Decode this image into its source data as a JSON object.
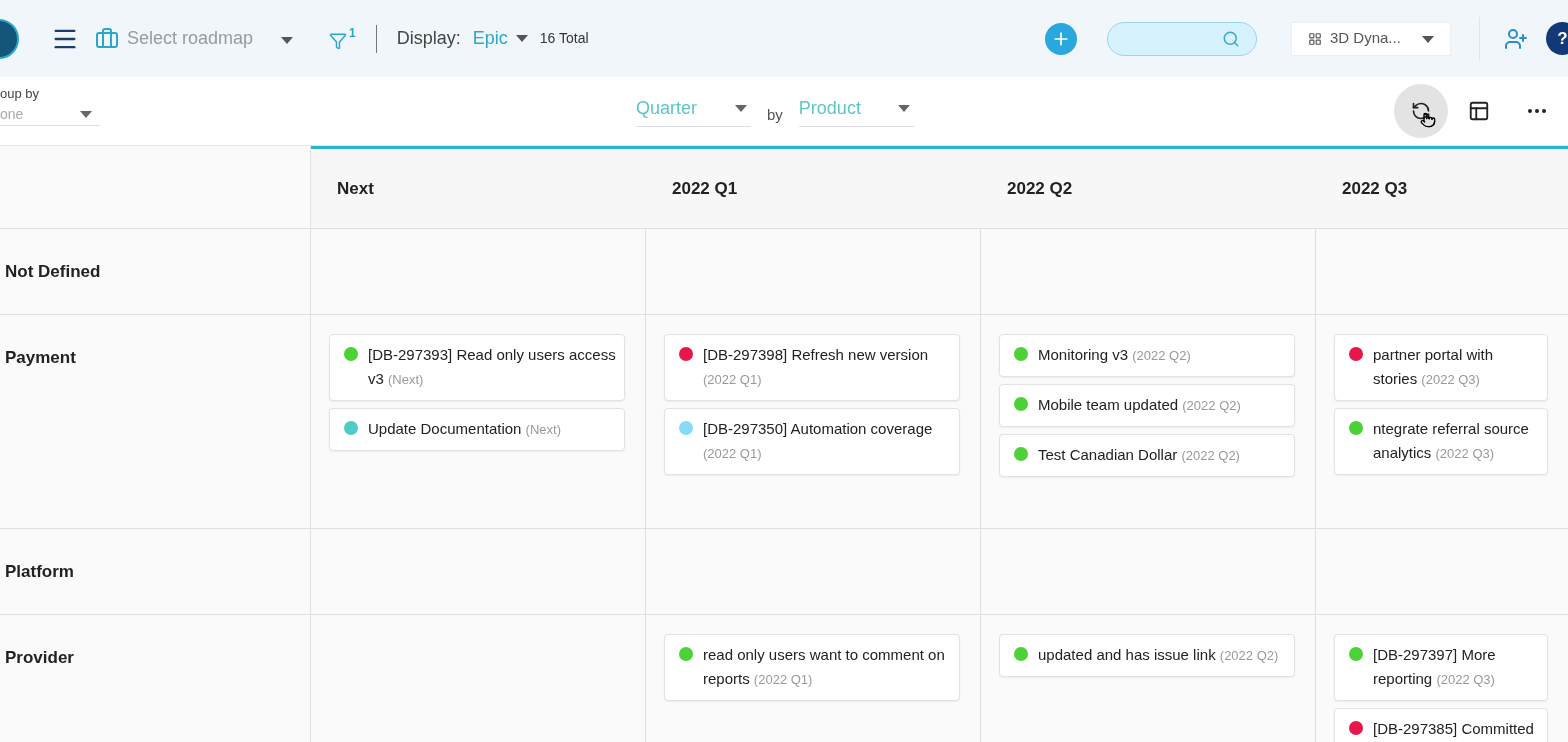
{
  "header": {
    "roadmap_select": "Select roadmap",
    "filter_count": "1",
    "display_label": "Display:",
    "display_value": "Epic",
    "total": "16 Total",
    "workspace": "3D Dyna...",
    "help": "?"
  },
  "toolbar": {
    "group_by_label": "oup by",
    "group_by_value": "one",
    "time_select": "Quarter",
    "by": "by",
    "dimension_select": "Product",
    "tools": [
      {
        "kind": "cycle",
        "hovered": true
      },
      {
        "kind": "layout",
        "hovered": false
      },
      {
        "kind": "more",
        "hovered": false
      }
    ]
  },
  "columns": [
    "Next",
    "2022 Q1",
    "2022 Q2",
    "2022 Q3"
  ],
  "rows": [
    {
      "label": "Not Defined",
      "cells": [
        [],
        [],
        [],
        []
      ]
    },
    {
      "label": "Payment",
      "cells": [
        [
          {
            "title": "[DB-297393] Read only users access v3",
            "period": "(Next)",
            "color": "#4cd137"
          },
          {
            "title": "Update Documentation",
            "period": "(Next)",
            "color": "#4ecdc4"
          }
        ],
        [
          {
            "title": "[DB-297398] Refresh new version",
            "period": "(2022 Q1)",
            "color": "#e8174a"
          },
          {
            "title": "[DB-297350] Automation coverage",
            "period": "(2022 Q1)",
            "color": "#87dcf5"
          }
        ],
        [
          {
            "title": "Monitoring v3",
            "period": "(2022 Q2)",
            "color": "#4cd137"
          },
          {
            "title": "Mobile team updated",
            "period": "(2022 Q2)",
            "color": "#4cd137"
          },
          {
            "title": "Test Canadian Dollar",
            "period": "(2022 Q2)",
            "color": "#4cd137"
          }
        ],
        [
          {
            "title": "partner portal with stories",
            "period": "(2022 Q3)",
            "color": "#e8174a"
          },
          {
            "title": "ntegrate referral source analytics",
            "period": "(2022 Q3)",
            "color": "#4cd137"
          }
        ]
      ]
    },
    {
      "label": "Platform",
      "cells": [
        [],
        [],
        [],
        []
      ]
    },
    {
      "label": "Provider",
      "cells": [
        [],
        [
          {
            "title": "read only users want to comment on reports",
            "period": "(2022 Q1)",
            "color": "#4cd137"
          }
        ],
        [
          {
            "title": "updated and has issue link",
            "period": "(2022 Q2)",
            "color": "#4cd137"
          }
        ],
        [
          {
            "title": "[DB-297397] More reporting",
            "period": "(2022 Q3)",
            "color": "#4cd137"
          },
          {
            "title": "[DB-297385] Committed",
            "color": "#e8174a"
          }
        ]
      ]
    }
  ]
}
